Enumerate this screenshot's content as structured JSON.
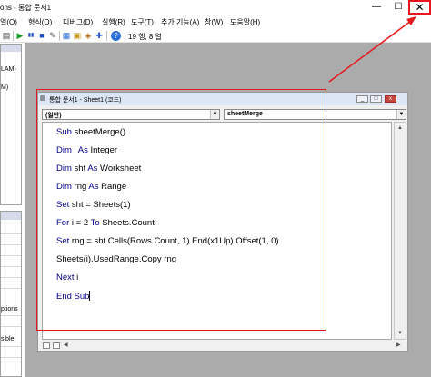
{
  "window": {
    "title": "ons - 통합 문서1",
    "min_glyph": "—",
    "max_glyph": "☐",
    "close_glyph": "✕"
  },
  "menu": {
    "items": [
      "열(O)",
      "형식(O)",
      "디버그(D)",
      "실행(R)",
      "도구(T)",
      "추가 기능(A)",
      "창(W)",
      "도움말(H)"
    ]
  },
  "toolbar": {
    "status_text": "19 행, 8 열",
    "run_glyph": "▶",
    "break_glyph": "▮▮",
    "reset_glyph": "■",
    "help_glyph": "?"
  },
  "left_panel": {
    "top_labels": [
      "LAM)",
      "M)"
    ],
    "bottom_labels": [
      "ptions",
      "sible"
    ]
  },
  "code_window": {
    "title": "통합 문서1 - Sheet1 (코드)",
    "object_combo": "(일반)",
    "proc_combo": "sheetMerge",
    "lines": [
      {
        "kw": "Sub",
        "rest": " sheetMerge()"
      },
      {
        "kw": "Dim",
        "mid": " i ",
        "kw2": "As",
        "rest": " Integer"
      },
      {
        "kw": "Dim",
        "mid": " sht ",
        "kw2": "As",
        "rest": " Worksheet"
      },
      {
        "kw": "Dim",
        "mid": " rng ",
        "kw2": "As",
        "rest": " Range"
      },
      {
        "kw": "Set",
        "rest": " sht = Sheets(1)"
      },
      {
        "kw": "For",
        "mid": " i = 2 ",
        "kw2": "To",
        "rest": " Sheets.Count"
      },
      {
        "kw": "Set",
        "rest": " rng = sht.Cells(Rows.Count, 1).End(x1Up).Offset(1, 0)"
      },
      {
        "kw": "",
        "rest": "Sheets(i).UsedRange.Copy rng"
      },
      {
        "kw": "Next",
        "rest": " i"
      },
      {
        "kw": "End Sub",
        "rest": ""
      }
    ]
  },
  "colors": {
    "annotation_red": "#e8171e",
    "keyword_blue": "#00008b"
  }
}
